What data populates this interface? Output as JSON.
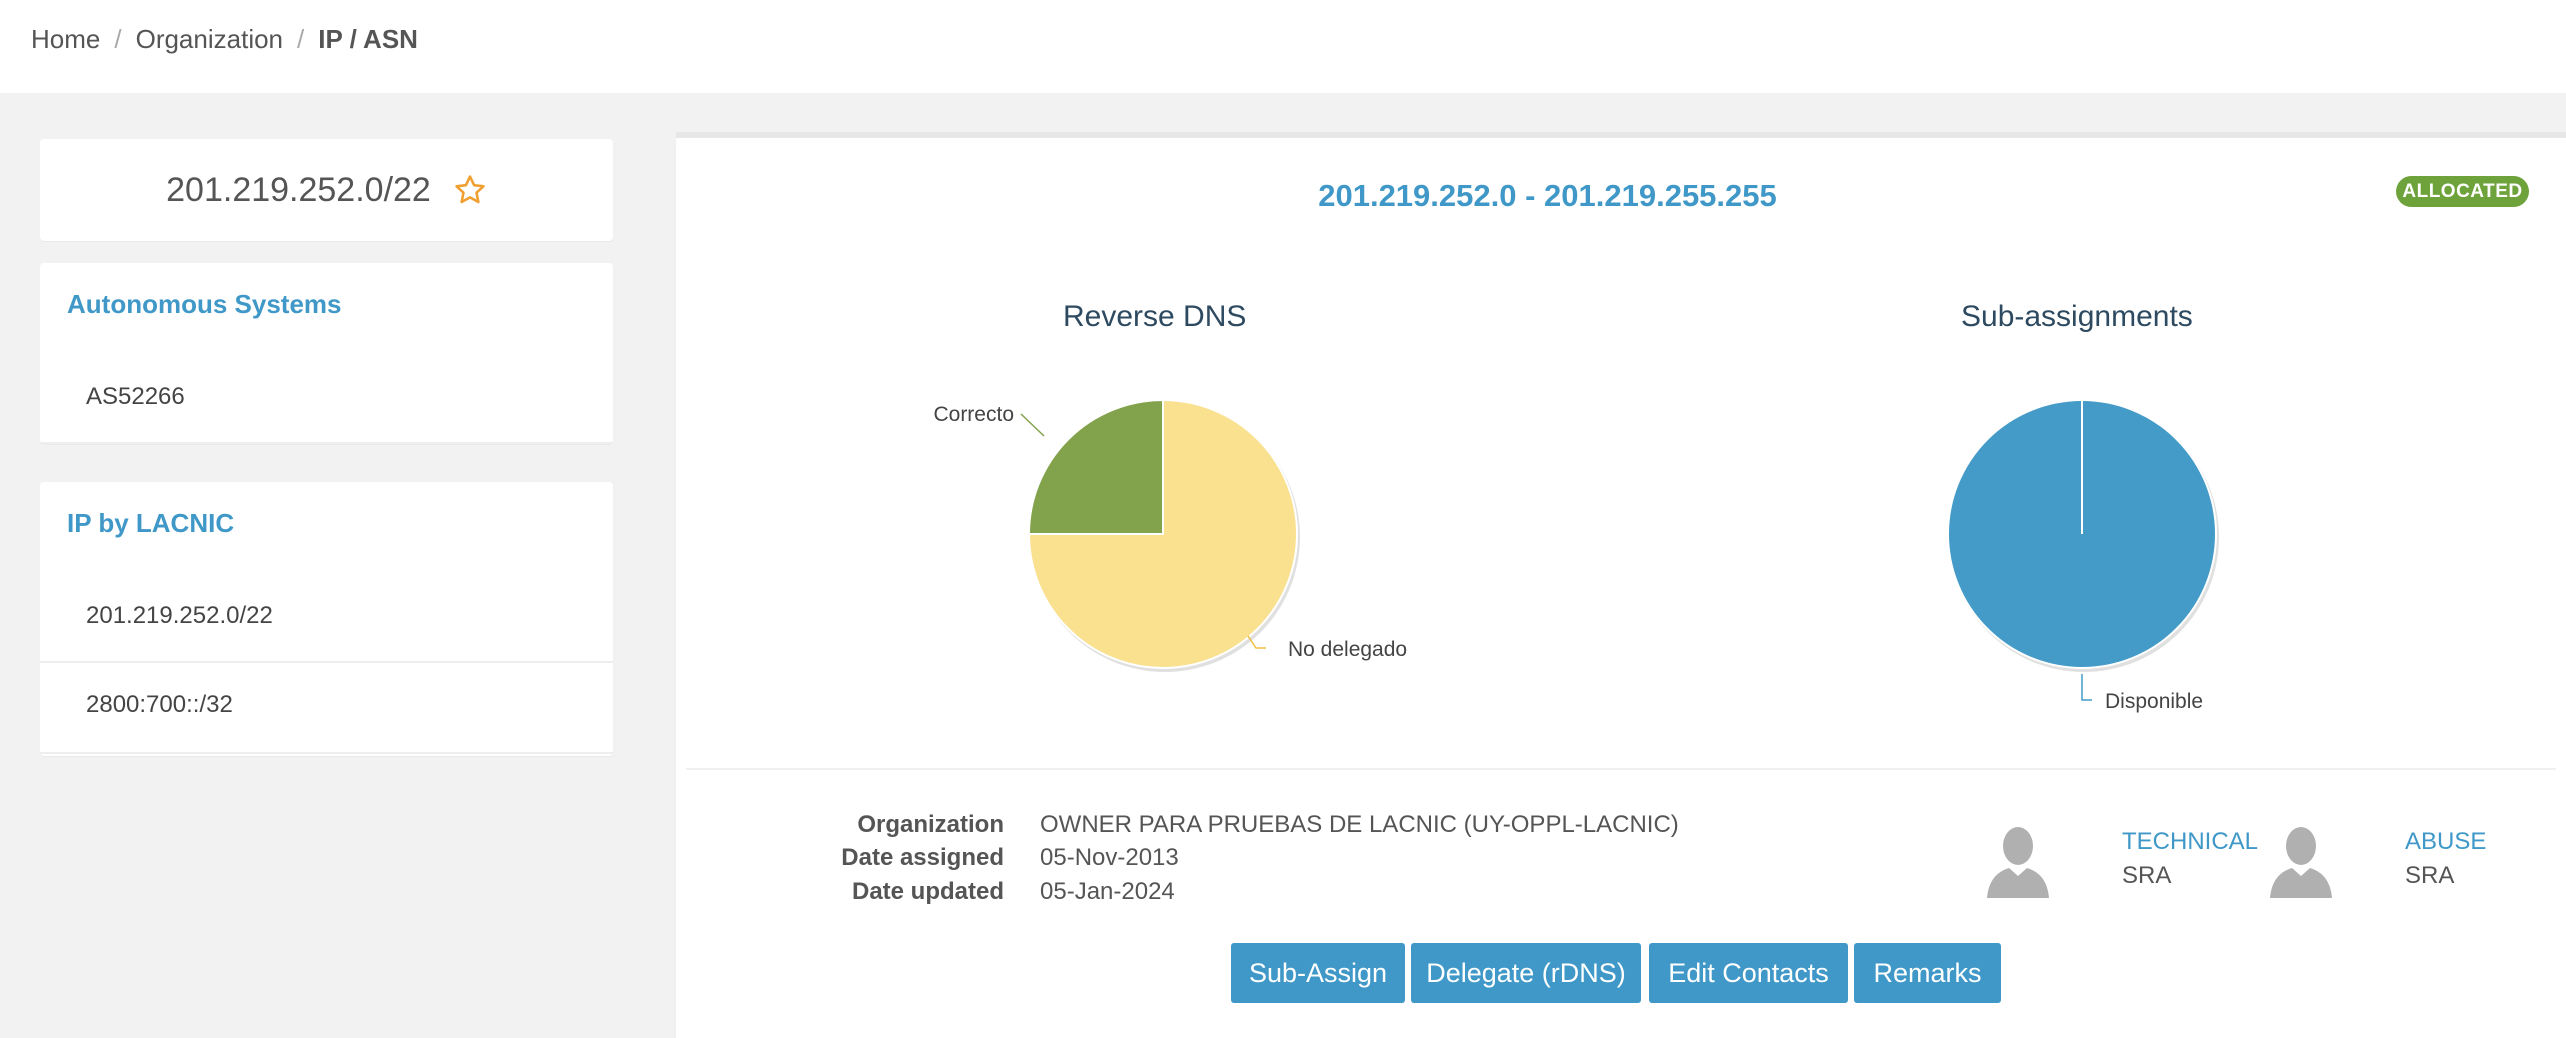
{
  "breadcrumb": {
    "items": [
      "Home",
      "Organization"
    ],
    "separator": "/",
    "current": "IP / ASN"
  },
  "prefix": {
    "title": "201.219.252.0/22",
    "favorite_icon": "star-icon"
  },
  "autonomous_systems": {
    "title": "Autonomous Systems",
    "items": [
      "AS52266"
    ]
  },
  "ip_by_lacnic": {
    "title": "IP by LACNIC",
    "items": [
      "201.219.252.0/22",
      "2800:700::/32"
    ]
  },
  "main": {
    "range": "201.219.252.0 - 201.219.255.255",
    "status": "ALLOCATED",
    "status_color": "#6ea23a"
  },
  "chart_data": [
    {
      "type": "pie",
      "title": "Reverse DNS",
      "slices": [
        {
          "label": "Correcto",
          "value": 25,
          "color": "#82a24c"
        },
        {
          "label": "No delegado",
          "value": 75,
          "color": "#f9e190"
        }
      ]
    },
    {
      "type": "pie",
      "title": "Sub-assignments",
      "slices": [
        {
          "label": "Disponible",
          "value": 100,
          "color": "#449bc8"
        }
      ]
    }
  ],
  "details": {
    "organization_label": "Organization",
    "organization_value": "OWNER PARA PRUEBAS DE LACNIC (UY-OPPL-LACNIC)",
    "date_assigned_label": "Date assigned",
    "date_assigned_value": "05-Nov-2013",
    "date_updated_label": "Date updated",
    "date_updated_value": "05-Jan-2024"
  },
  "contacts": [
    {
      "role": "TECHNICAL",
      "name": "SRA",
      "icon": "user-avatar-icon"
    },
    {
      "role": "ABUSE",
      "name": "SRA",
      "icon": "user-avatar-icon"
    }
  ],
  "actions": [
    "Sub-Assign",
    "Delegate (rDNS)",
    "Edit Contacts",
    "Remarks"
  ],
  "colors": {
    "accent": "#3f98c7",
    "allocated": "#6ea23a"
  }
}
